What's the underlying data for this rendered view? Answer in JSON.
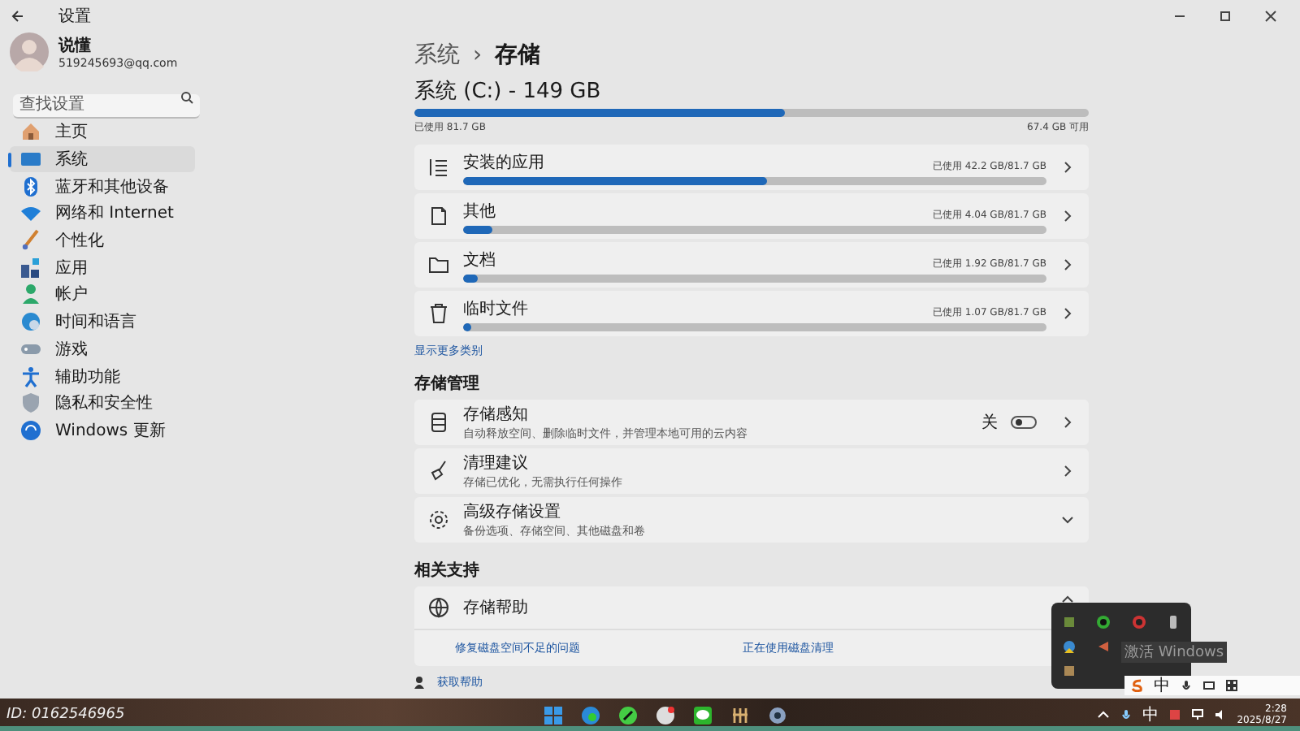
{
  "window": {
    "title": "设置"
  },
  "user": {
    "name": "说懂",
    "email": "519245693@qq.com"
  },
  "search": {
    "placeholder": "查找设置"
  },
  "nav": [
    {
      "kind": "home",
      "label": "主页",
      "selected": false
    },
    {
      "kind": "system",
      "label": "系统",
      "selected": true
    },
    {
      "kind": "bluetooth",
      "label": "蓝牙和其他设备",
      "selected": false
    },
    {
      "kind": "network",
      "label": "网络和 Internet",
      "selected": false
    },
    {
      "kind": "brush",
      "label": "个性化",
      "selected": false
    },
    {
      "kind": "apps",
      "label": "应用",
      "selected": false
    },
    {
      "kind": "account",
      "label": "帐户",
      "selected": false
    },
    {
      "kind": "time",
      "label": "时间和语言",
      "selected": false
    },
    {
      "kind": "game",
      "label": "游戏",
      "selected": false
    },
    {
      "kind": "access",
      "label": "辅助功能",
      "selected": false
    },
    {
      "kind": "privacy",
      "label": "隐私和安全性",
      "selected": false
    },
    {
      "kind": "update",
      "label": "Windows 更新",
      "selected": false
    }
  ],
  "breadcrumb": {
    "parent": "系统",
    "separator": "›",
    "current": "存储"
  },
  "drive": {
    "title": "系统 (C:) - 149 GB",
    "level": 0.55,
    "used": "已使用 81.7 GB",
    "free": "67.4 GB 可用"
  },
  "categories": [
    {
      "kind": "apps",
      "name": "安装的应用",
      "usage": "已使用 42.2 GB/81.7 GB",
      "level": 0.52
    },
    {
      "kind": "other",
      "name": "其他",
      "usage": "已使用 4.04 GB/81.7 GB",
      "level": 0.05
    },
    {
      "kind": "docs",
      "name": "文档",
      "usage": "已使用 1.92 GB/81.7 GB",
      "level": 0.024
    },
    {
      "kind": "temp",
      "name": "临时文件",
      "usage": "已使用 1.07 GB/81.7 GB",
      "level": 0.013
    }
  ],
  "show_more": "显示更多类别",
  "management": {
    "heading": "存储管理",
    "items": [
      {
        "kind": "sense",
        "title": "存储感知",
        "subtitle": "自动释放空间、删除临时文件，并管理本地可用的云内容",
        "toggle": {
          "label": "关",
          "on": false
        }
      },
      {
        "kind": "cleanup",
        "title": "清理建议",
        "subtitle": "存储已优化，无需执行任何操作"
      },
      {
        "kind": "advanced",
        "title": "高级存储设置",
        "subtitle": "备份选项、存储空间、其他磁盘和卷",
        "expanded": false
      }
    ]
  },
  "support": {
    "heading": "相关支持",
    "title": "存储帮助",
    "expanded": true,
    "links": [
      "修复磁盘空间不足的问题",
      "正在使用磁盘清理"
    ]
  },
  "get_help": "获取帮助",
  "overlay_id": "ID: 0162546965",
  "activation": "激活 Windows",
  "ime_bar": {
    "label": "中"
  },
  "taskbar": {
    "ime": "中",
    "clock": "2:28",
    "date": "2025/8/27"
  }
}
